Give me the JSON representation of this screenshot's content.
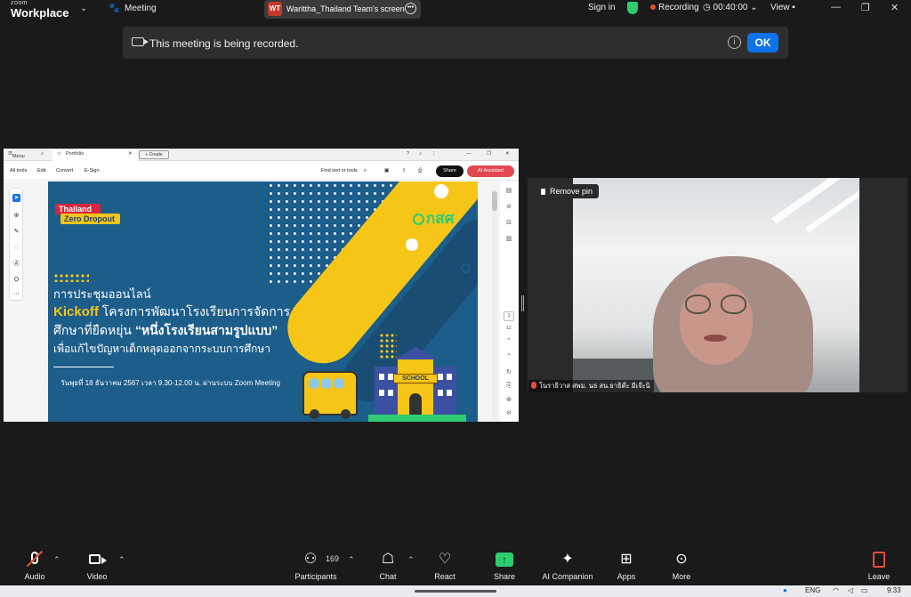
{
  "titlebar": {
    "logo_line1": "zoom",
    "logo_line2": "Workplace",
    "meeting_label": "Meeting",
    "screen_owner_initials": "WT",
    "screen_label": "Warittha_Thailand Team's screen",
    "sign_in": "Sign in",
    "recording": "Recording",
    "timer": "00:40:00",
    "view": "View"
  },
  "banner": {
    "message": "This meeting is being recorded.",
    "ok_label": "OK"
  },
  "shared_window": {
    "menu_label": "Menu",
    "tab_label": "Portfolio",
    "create_label": "+ Create",
    "toolbar": {
      "all_tools": "All tools",
      "edit": "Edit",
      "convert": "Convert",
      "esign": "E-Sign",
      "find": "Find text or tools",
      "share": "Share",
      "ai": "AI Assistant"
    },
    "page_current": "1",
    "page_total": "12",
    "poster": {
      "badge_line1": "Thailand",
      "badge_line2": "Zero Dropout",
      "org": "กสศ",
      "line1": "การประชุมออนไลน์",
      "line2_bold": "Kickoff",
      "line2_rest": "โครงการพัฒนาโรงเรียนการจัดการ",
      "line3_rest": "ศึกษาที่ยืดหยุ่น",
      "line3_bold": "“หนึ่งโรงเรียนสามรูปแบบ”",
      "line4": "เพื่อแก้ไขปัญหาเด็กหลุดออกจากระบบการศึกษา",
      "date": "วันพุธที่ 18 ธันวาคม 2567 เวลา 9.30-12.00 น. ผ่านระบบ Zoom Meeting",
      "school_sign": "SCHOOL"
    }
  },
  "video": {
    "remove_pin": "Remove pin",
    "participant_name": "โนราธิวาส สพม. นธ สน.ธาธิต๊ะ มีเจ๊ะนิ"
  },
  "bottombar": {
    "audio": "Audio",
    "video": "Video",
    "participants": "Participants",
    "participants_count": "169",
    "chat": "Chat",
    "react": "React",
    "share": "Share",
    "ai_companion": "AI Companion",
    "apps": "Apps",
    "more": "More",
    "leave": "Leave"
  },
  "taskbar": {
    "lang": "ENG",
    "time": "9:33"
  },
  "colors": {
    "zoom_blue": "#0e72ed",
    "recording_red": "#e74c3c",
    "share_green": "#2ecc71",
    "poster_blue": "#1c5d8a",
    "poster_yellow": "#f5c518"
  }
}
